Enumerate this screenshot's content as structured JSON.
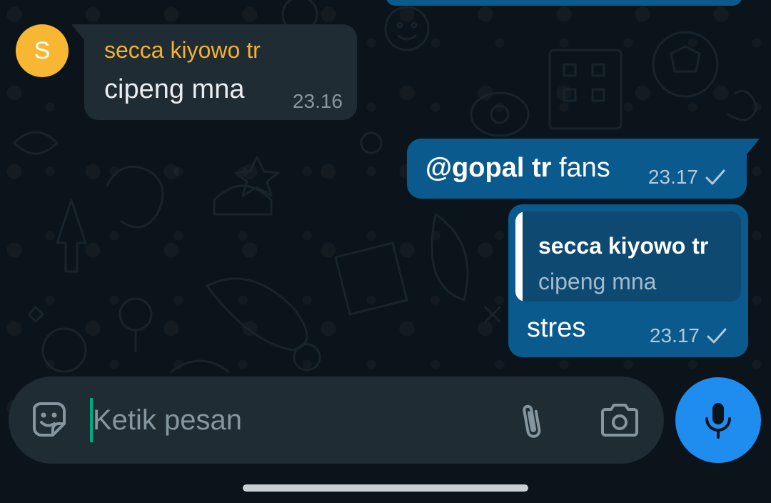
{
  "messages": {
    "incoming": {
      "avatar_initial": "S",
      "avatar_color": "#f7b733",
      "sender": "secca kiyowo tr",
      "sender_color": "#f6b02f",
      "text": "cipeng mna",
      "time": "23.16"
    },
    "outgoing": [
      {
        "mention": "@gopal tr",
        "text": " fans",
        "time": "23.17",
        "status": "check-icon"
      },
      {
        "reply_to": {
          "sender": "secca kiyowo tr",
          "text": "cipeng mna"
        },
        "text": "stres",
        "time": "23.17",
        "status": "check-icon"
      }
    ]
  },
  "composer": {
    "placeholder": "Ketik pesan",
    "value": "",
    "icons": {
      "emoji": "sticker-icon",
      "attach": "paperclip-icon",
      "camera": "camera-icon",
      "mic": "microphone-icon"
    }
  },
  "colors": {
    "outgoing_bubble": "#0a5a8e",
    "incoming_bubble": "#1f2c33",
    "mic_button": "#1f8df0",
    "cursor": "#00a884"
  }
}
